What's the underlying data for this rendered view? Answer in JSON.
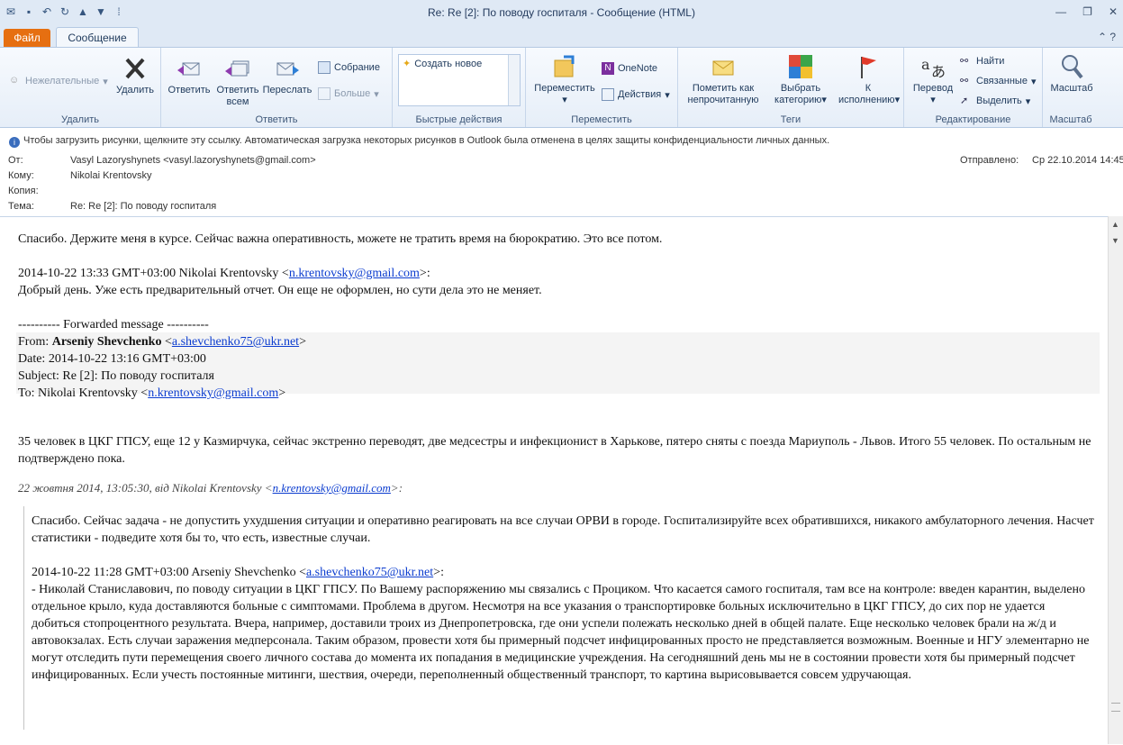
{
  "window": {
    "title": "Re: Re [2]: По поводу госпиталя  -  Сообщение (HTML)",
    "tabs": {
      "file": "Файл",
      "message": "Сообщение"
    }
  },
  "ribbon": {
    "delete_group": {
      "label": "Удалить",
      "junk": "Нежелательные",
      "delete": "Удалить"
    },
    "respond_group": {
      "label": "Ответить",
      "reply": "Ответить",
      "reply_all_1": "Ответить",
      "reply_all_2": "всем",
      "forward": "Переслать",
      "meeting": "Собрание",
      "more": "Больше"
    },
    "quick_steps": {
      "label": "Быстрые действия",
      "create_new": "Создать новое"
    },
    "move_group": {
      "label": "Переместить",
      "move": "Переместить",
      "onenote": "OneNote",
      "actions": "Действия"
    },
    "tags_group": {
      "label": "Теги",
      "mark_unread_1": "Пометить как",
      "mark_unread_2": "непрочитанную",
      "categorize_1": "Выбрать",
      "categorize_2": "категорию",
      "followup_1": "К",
      "followup_2": "исполнению"
    },
    "editing_group": {
      "label": "Редактирование",
      "translate": "Перевод",
      "find": "Найти",
      "related": "Связанные",
      "select": "Выделить"
    },
    "zoom_group": {
      "label": "Масштаб",
      "zoom": "Масштаб"
    }
  },
  "infobar": "Чтобы загрузить рисунки, щелкните эту ссылку. Автоматическая загрузка некоторых рисунков в Outlook была отменена в целях защиты конфиденциальности личных данных.",
  "header": {
    "from_label": "От:",
    "from": "Vasyl Lazoryshynets <vasyl.lazoryshynets@gmail.com>",
    "to_label": "Кому:",
    "to": "Nikolai Krentovsky",
    "cc_label": "Копия:",
    "cc": "",
    "subject_label": "Тема:",
    "subject": "Re: Re [2]: По поводу госпиталя",
    "sent_label": "Отправлено:",
    "sent": "Ср 22.10.2014 14:45"
  },
  "body": {
    "p1": "Спасибо. Держите меня в курсе. Сейчас важна оперативность, можете не тратить время на бюрократию. Это все потом.",
    "reply1_head_pre": "2014-10-22 13:33 GMT+03:00 Nikolai Krentovsky <",
    "reply1_email": "n.krentovsky@gmail.com",
    "reply1_head_post": ">:",
    "reply1_text": "Добрый день. Уже есть предварительный отчет. Он еще не оформлен, но сути дела это не меняет.",
    "fwd_line": "---------- Forwarded message ----------",
    "fwd_from_label": "From: ",
    "fwd_from_name": "Arseniy Shevchenko",
    "fwd_from_pre": " <",
    "fwd_from_email": "a.shevchenko75@ukr.net",
    "fwd_from_post": ">",
    "fwd_date": "Date: 2014-10-22 13:16 GMT+03:00",
    "fwd_subject": "Subject: Re [2]: По поводу госпиталя",
    "fwd_to_pre": "To: Nikolai Krentovsky <",
    "fwd_to_email": "n.krentovsky@gmail.com",
    "fwd_to_post": ">",
    "p_stats": "35 человек в ЦКГ ГПСУ, еще 12 у Казмирчука, сейчас экстренно переводят, две медсестры и инфекционист в Харькове, пятеро сняты с поезда Мариуполь - Львов. Итого 55 человек. По остальным не подтверждено пока.",
    "intro_pre": "22 жовтня 2014, 13:05:30, від Nikolai Krentovsky <",
    "intro_email": "n.krentovsky@gmail.com",
    "intro_post": ">:",
    "q1": "Спасибо. Сейчас задача - не допустить ухудшения ситуации и оперативно реагировать на все случаи ОРВИ в городе. Госпитализируйте всех обратившихся, никакого амбулаторного лечения. Насчет статистики - подведите хотя бы то, что есть, известные случаи.",
    "q2_head_pre": "2014-10-22 11:28 GMT+03:00 Arseniy Shevchenko <",
    "q2_email": "a.shevchenko75@ukr.net",
    "q2_head_post": ">:",
    "q2_text": "- Николай Станиславович, по поводу ситуации в ЦКГ ГПСУ. По Вашему распоряжению мы связались с Проциком. Что касается самого госпиталя, там все на контроле: введен карантин, выделено отдельное крыло, куда доставляются больные с симптомами.  Проблема в другом. Несмотря на все указания о транспортировке больных исключительно в ЦКГ ГПСУ, до сих пор не удается добиться стопроцентного результата. Вчера, например, доставили троих из Днепропетровска, где они успели полежать несколько дней в общей палате. Еще несколько человек брали на ж/д и автовокзалах. Есть случаи заражения медперсонала. Таким образом, провести хотя бы примерный подсчет инфицированных просто не представляется возможным. Военные и НГУ элементарно не могут отследить пути перемещения своего личного состава до момента их попадания в медицинские учреждения. На сегодняшний день мы не в состоянии провести хотя бы примерный подсчет инфицированных. Если учесть постоянные митинги, шествия, очереди, переполненный общественный транспорт, то картина вырисовывается совсем удручающая."
  },
  "colors": {
    "file_tab": "#e66f11",
    "link": "#0b3ccf",
    "ribbon": "#e6eef8"
  }
}
